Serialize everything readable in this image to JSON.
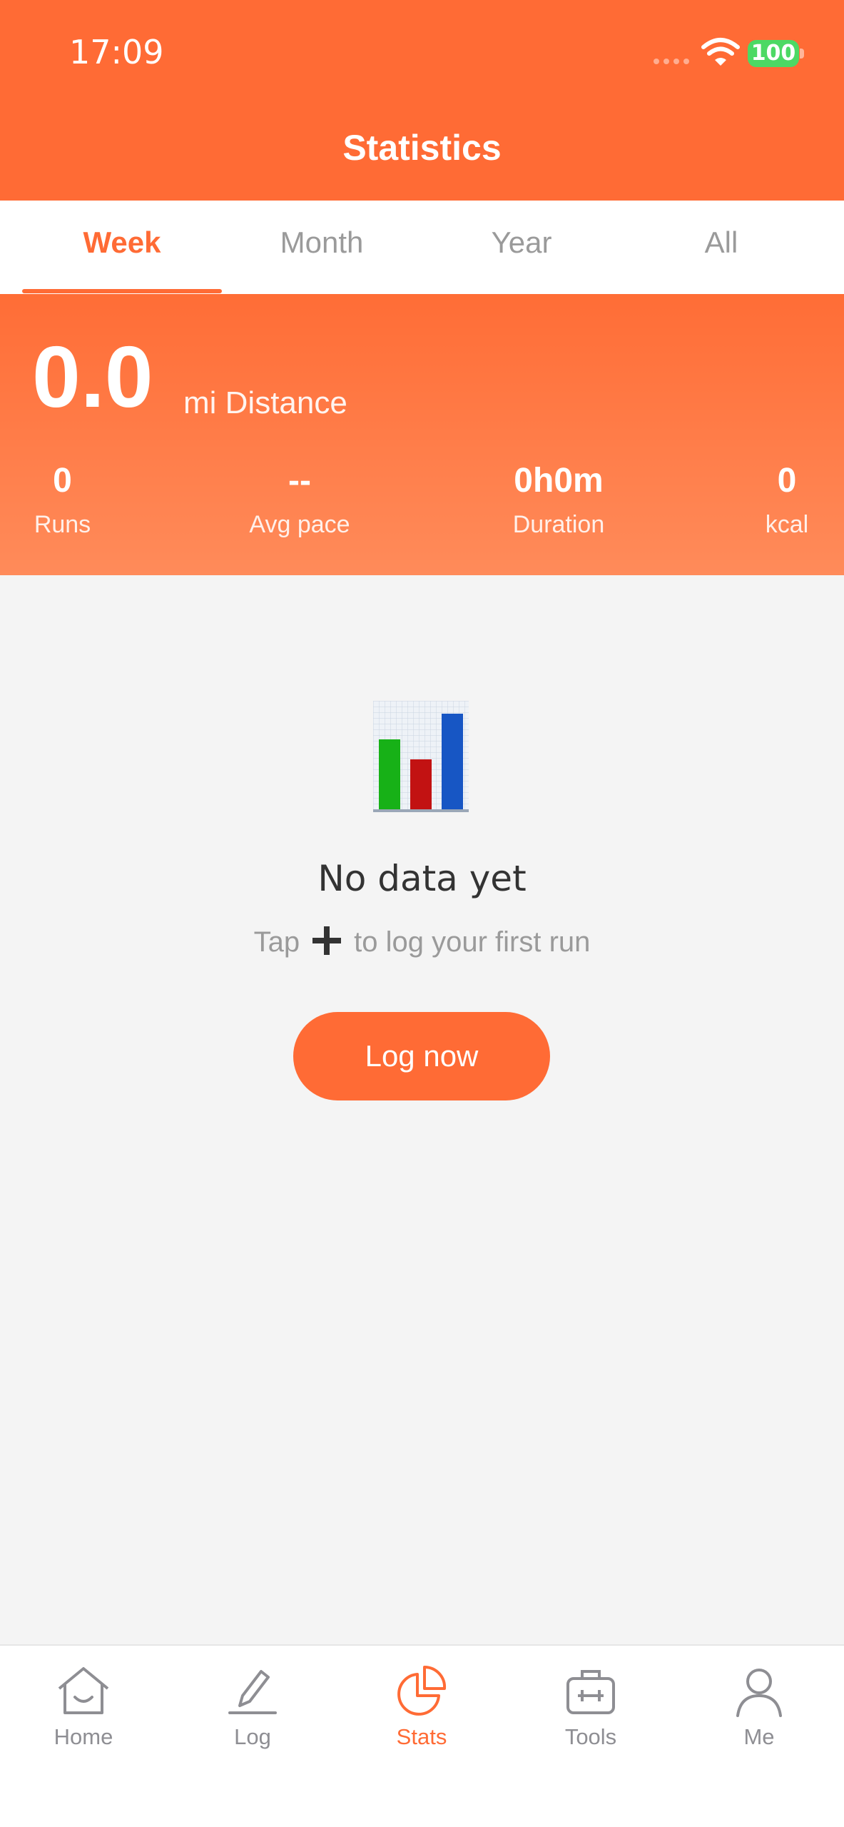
{
  "status_bar": {
    "time": "17:09",
    "battery": "100"
  },
  "header": {
    "title": "Statistics"
  },
  "tabs": [
    {
      "label": "Week",
      "active": true
    },
    {
      "label": "Month",
      "active": false
    },
    {
      "label": "Year",
      "active": false
    },
    {
      "label": "All",
      "active": false
    }
  ],
  "summary": {
    "distance_value": "0.0",
    "distance_label": "mi Distance",
    "stats": [
      {
        "value": "0",
        "label": "Runs"
      },
      {
        "value": "--",
        "label": "Avg pace"
      },
      {
        "value": "0h0m",
        "label": "Duration"
      },
      {
        "value": "0",
        "label": "kcal"
      }
    ]
  },
  "empty_state": {
    "icon": "bar-chart-icon",
    "title": "No data yet",
    "subtitle_prefix": "Tap",
    "subtitle_suffix": "to log your first run",
    "button_label": "Log now"
  },
  "tab_bar": [
    {
      "label": "Home",
      "icon": "home-icon",
      "active": false
    },
    {
      "label": "Log",
      "icon": "pencil-icon",
      "active": false
    },
    {
      "label": "Stats",
      "icon": "pie-chart-icon",
      "active": true
    },
    {
      "label": "Tools",
      "icon": "toolbox-icon",
      "active": false
    },
    {
      "label": "Me",
      "icon": "person-icon",
      "active": false
    }
  ],
  "colors": {
    "accent": "#ff6b35",
    "background": "#f4f4f4",
    "battery": "#4cd964"
  }
}
